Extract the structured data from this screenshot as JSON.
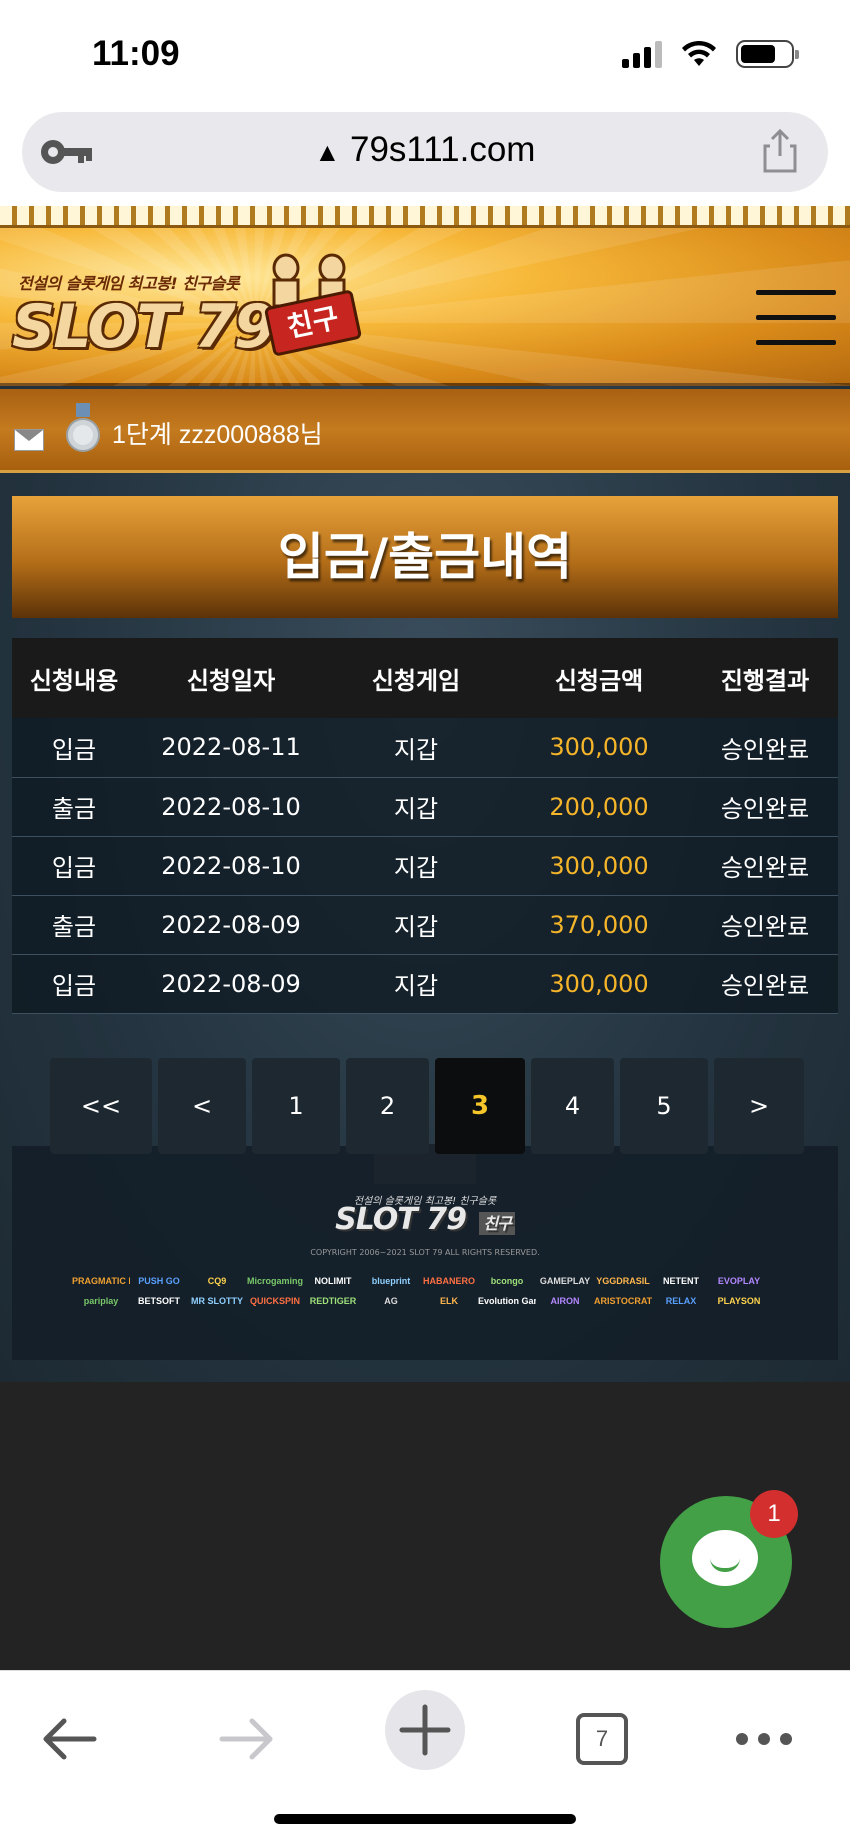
{
  "status_bar": {
    "time": "11:09"
  },
  "browser": {
    "url": "79s111.com"
  },
  "site": {
    "logo": {
      "tagline": "전설의 슬롯게임 최고봉! 친구슬롯",
      "name": "SLOT 79",
      "badge": "친구"
    },
    "user": {
      "label": "1단계 zzz000888님"
    },
    "page_title": "입금/출금내역",
    "table": {
      "headers": [
        "신청내용",
        "신청일자",
        "신청게임",
        "신청금액",
        "진행결과"
      ],
      "rows": [
        [
          "입금",
          "2022-08-11",
          "지갑",
          "300,000",
          "승인완료"
        ],
        [
          "출금",
          "2022-08-10",
          "지갑",
          "200,000",
          "승인완료"
        ],
        [
          "입금",
          "2022-08-10",
          "지갑",
          "300,000",
          "승인완료"
        ],
        [
          "출금",
          "2022-08-09",
          "지갑",
          "370,000",
          "승인완료"
        ],
        [
          "입금",
          "2022-08-09",
          "지갑",
          "300,000",
          "승인완료"
        ]
      ]
    },
    "pagination": {
      "first": "<<",
      "prev": "<",
      "pages": [
        "1",
        "2",
        "3",
        "4",
        "5"
      ],
      "current": "3",
      "next": ">"
    },
    "footer": {
      "tagline": "전설의 슬롯게임 최고봉! 친구슬롯",
      "logo": "SLOT 79",
      "badge": "친구",
      "copyright": "COPYRIGHT 2006~2021 SLOT 79 ALL RIGHTS RESERVED.",
      "partners_row1": [
        "PRAGMATIC PLAY",
        "PUSH GO",
        "CQ9",
        "Microgaming",
        "NOLIMIT",
        "blueprint",
        "HABANERO",
        "bcongo",
        "GAMEPLAY",
        "YGGDRASIL",
        "NETENT",
        "EVOPLAY"
      ],
      "partners_row2": [
        "pariplay",
        "BETSOFT",
        "MR SLOTTY",
        "QUICKSPIN",
        "REDTIGER",
        "AG",
        "ELK",
        "Evolution Gaming",
        "AIRON",
        "ARISTOCRAT",
        "RELAX",
        "PLAYSON"
      ]
    },
    "chat": {
      "badge_count": "1"
    }
  },
  "toolbar": {
    "tabs_count": "7"
  },
  "colors": {
    "amount": "#f5b52a",
    "active_page": "#f5c52a",
    "chat_green": "#43a047",
    "badge_red": "#d32f2f"
  }
}
